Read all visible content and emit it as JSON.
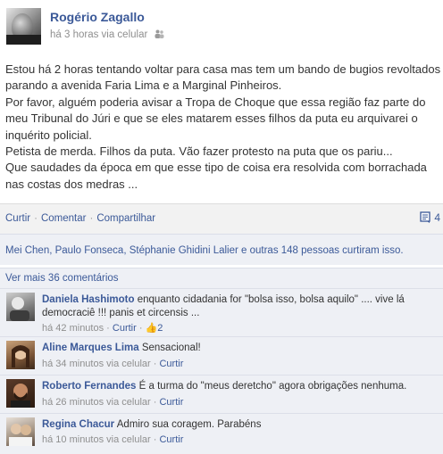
{
  "post": {
    "author": "Rogério Zagallo",
    "meta": "há 3 horas via celular",
    "paragraphs": [
      "Estou há 2 horas tentando voltar para casa mas tem um bando de bugios revoltados parando a avenida Faria Lima e a Marginal Pinheiros.",
      "Por favor, alguém poderia avisar a Tropa de Choque que essa região faz parte do meu Tribunal do Júri e que se eles matarem esses filhos da puta eu arquivarei o inquérito policial.",
      "Petista de merda. Filhos da puta. Vão fazer protesto na puta que os pariu...",
      "Que saudades da época em que esse tipo de coisa era resolvida com borrachada nas costas dos medras ..."
    ],
    "audience_icon": "friends-icon"
  },
  "actions": {
    "curtir": "Curtir",
    "comentar": "Comentar",
    "compartilhar": "Compartilhar",
    "separator": "·",
    "comment_count": "4",
    "comment_count_icon": "comment-bubble-icon"
  },
  "likes": {
    "text": "Mei Chen, Paulo Fonseca, Stéphanie Ghidini Lalier e outras 148 pessoas curtiram isso."
  },
  "view_more": "Ver mais 36 comentários",
  "comments": [
    {
      "name": "Daniela Hashimoto",
      "text": "enquanto cidadania for \"bolsa isso, bolsa aquilo\" .... vive lá democraciê !!! panis et circensis ...",
      "time": "há 42 minutos",
      "like_label": "Curtir",
      "like_count": "2"
    },
    {
      "name": "Aline Marques Lima",
      "text": "Sensacional!",
      "time": "há 34 minutos via celular",
      "like_label": "Curtir"
    },
    {
      "name": "Roberto Fernandes",
      "text": "É a turma do \"meus deretcho\" agora obrigações nenhuma.",
      "time": "há 26 minutos via celular",
      "like_label": "Curtir"
    },
    {
      "name": "Regina Chacur",
      "text": "Admiro sua coragem. Parabéns",
      "time": "há 10 minutos via celular",
      "like_label": "Curtir"
    }
  ],
  "colors": {
    "link_blue": "#3b5998",
    "meta_gray": "#8f8f8f",
    "comment_bg": "#eef0f5"
  }
}
